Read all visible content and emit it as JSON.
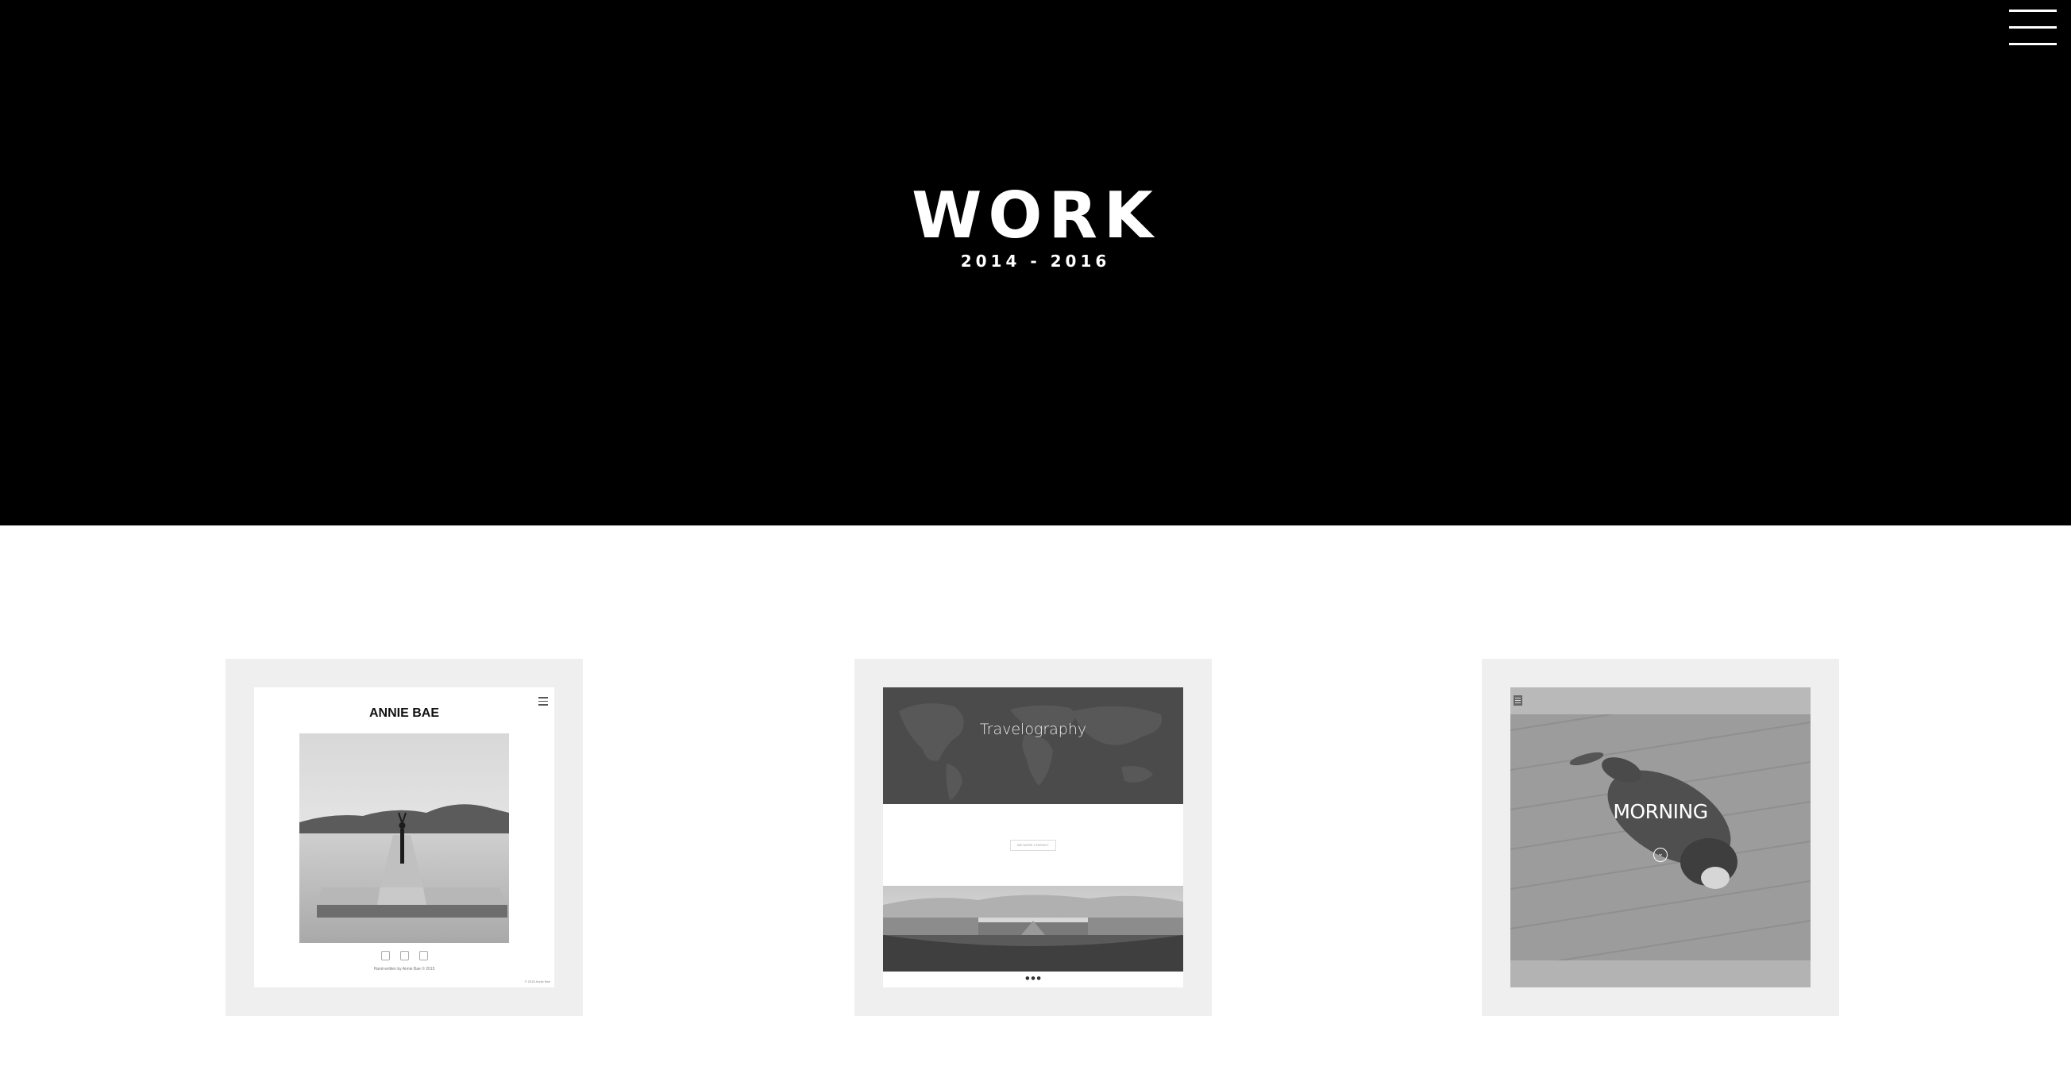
{
  "hero": {
    "title": "WORK",
    "subtitle": "2014 - 2016",
    "background_color": "#000000",
    "menu_icon": "hamburger-menu-icon"
  },
  "projects": [
    {
      "title": "ANNIE BAE",
      "menu_icon": "hamburger-menu-icon",
      "social_icons": [
        "instagram-icon",
        "twitter-icon",
        "email-icon"
      ],
      "caption": "Hand-written by Annie Bae © 2015",
      "copyright": "© 2015 Annie Bae"
    },
    {
      "title": "Travelography",
      "nav_links": "ME  WORK  CONTACT"
    },
    {
      "title": "MORNING",
      "scroll_icon": "chevron-down-circle-icon"
    }
  ],
  "colors": {
    "card_background": "#efefef",
    "page_background": "#ffffff"
  }
}
